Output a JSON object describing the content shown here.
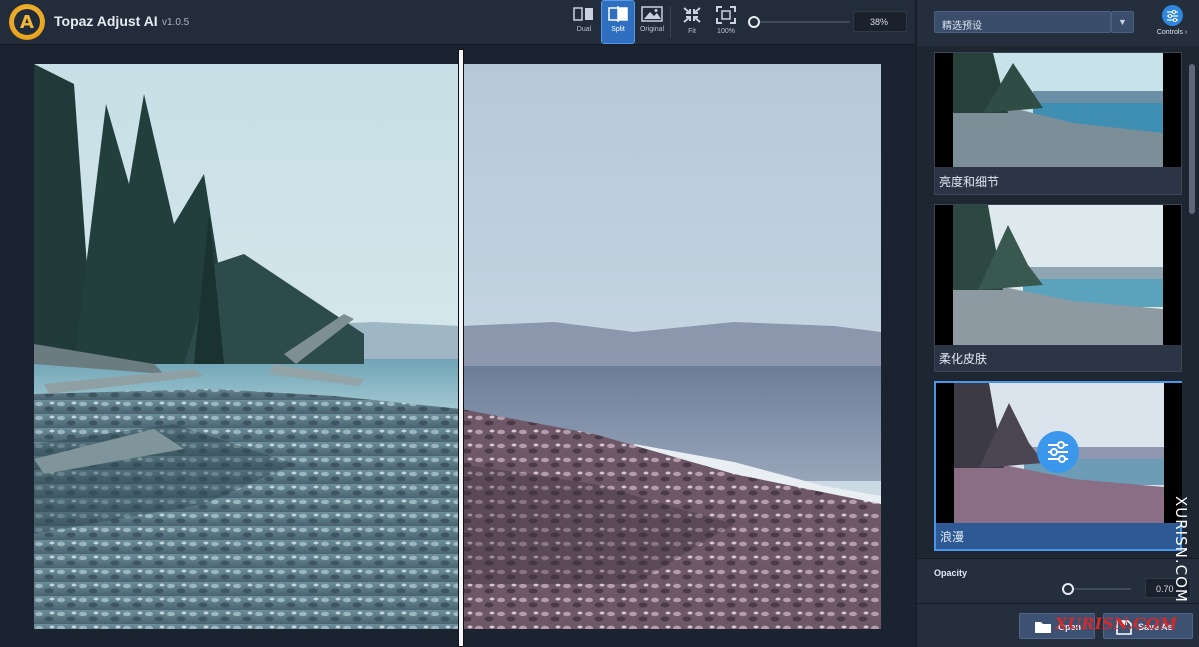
{
  "app": {
    "title": "Topaz Adjust AI",
    "version": "v1.0.5",
    "logo_letter": "A"
  },
  "toolbar": {
    "view_modes": [
      {
        "label": "Dual",
        "icon": "dual-view-icon",
        "active": false
      },
      {
        "label": "Split",
        "icon": "split-view-icon",
        "active": true
      },
      {
        "label": "Original",
        "icon": "original-image-icon",
        "active": false
      }
    ],
    "zoom_modes": [
      {
        "label": "Fit",
        "icon": "fit-icon"
      },
      {
        "label": "100%",
        "icon": "actual-size-icon"
      }
    ],
    "zoom_value": "38%",
    "zoom_level": 0.0
  },
  "panel": {
    "preset_dropdown": "精选预设",
    "controls_label": "Controls ›",
    "presets": [
      {
        "name": "亮度和细节",
        "selected": false
      },
      {
        "name": "柔化皮肤",
        "selected": false
      },
      {
        "name": "浪漫",
        "selected": true
      }
    ],
    "opacity": {
      "label": "Opacity",
      "value": "0.70",
      "level": 0.0
    },
    "buttons": {
      "open": "Open",
      "save_as": "Save As"
    }
  },
  "watermark": {
    "vertical": "XURISN.COM",
    "horizontal": "XURISN.COM"
  },
  "colors": {
    "accent": "#2f87e0",
    "active_tab": "#2e6fc0",
    "panel_bg": "#252e3d",
    "app_bg": "#1b2230"
  }
}
